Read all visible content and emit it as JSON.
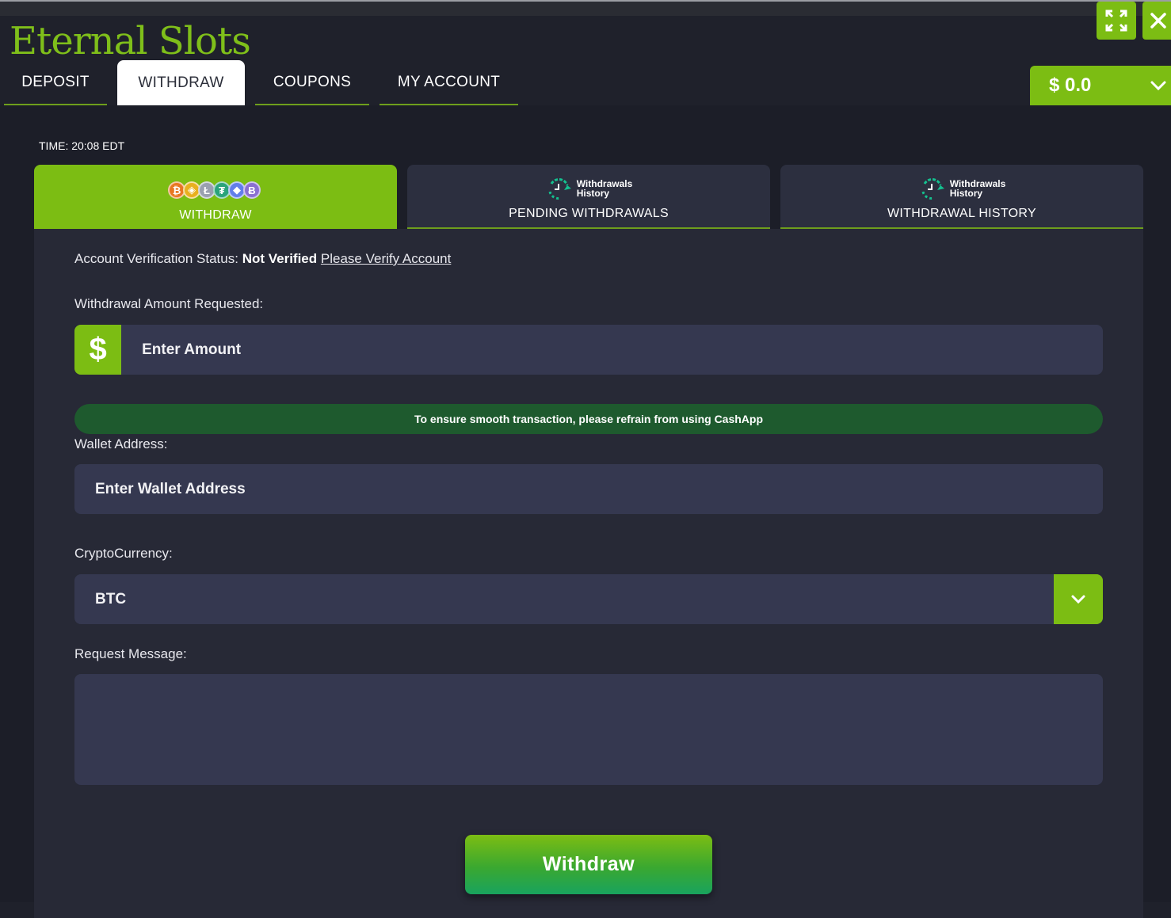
{
  "app": {
    "logo": "Eternal Slots"
  },
  "nav": {
    "tabs": [
      {
        "label": "DEPOSIT",
        "active": false
      },
      {
        "label": "WITHDRAW",
        "active": true
      },
      {
        "label": "COUPONS",
        "active": false
      },
      {
        "label": "MY ACCOUNT",
        "active": false
      }
    ],
    "balance": "$ 0.0"
  },
  "time": "TIME: 20:08 EDT",
  "subtabs": [
    {
      "label": "WITHDRAW",
      "active": true,
      "coins": [
        "₿",
        "◈",
        "Ł",
        "₮",
        "◆",
        "Ƀ"
      ]
    },
    {
      "label": "PENDING WITHDRAWALS",
      "active": false,
      "icon_line1": "Withdrawals",
      "icon_line2": "History"
    },
    {
      "label": "WITHDRAWAL HISTORY",
      "active": false,
      "icon_line1": "Withdrawals",
      "icon_line2": "History"
    }
  ],
  "form": {
    "verification_label": "Account Verification Status:",
    "verification_value": "Not Verified",
    "verification_link": "Please Verify Account",
    "amount_label": "Withdrawal Amount Requested:",
    "amount_placeholder": "Enter Amount",
    "currency_symbol": "$",
    "notice": "To ensure smooth transaction, please refrain from using CashApp",
    "wallet_label": "Wallet Address:",
    "wallet_placeholder": "Enter Wallet Address",
    "crypto_label": "CryptoCurrency:",
    "crypto_selected": "BTC",
    "message_label": "Request Message:",
    "message_placeholder": "",
    "submit_label": "Withdraw"
  },
  "colors": {
    "accent": "#7cbd13",
    "notice_bg": "#1e5a2e",
    "background": "#1f212b",
    "panel": "#272936",
    "field": "#353850"
  },
  "icons": {
    "expand": "expand-icon",
    "close": "close-icon",
    "balance_dropdown": "chevron-down-icon",
    "crypto_dropdown": "chevron-down-icon",
    "history": "history-icon",
    "coins": "crypto-coins-icon"
  }
}
